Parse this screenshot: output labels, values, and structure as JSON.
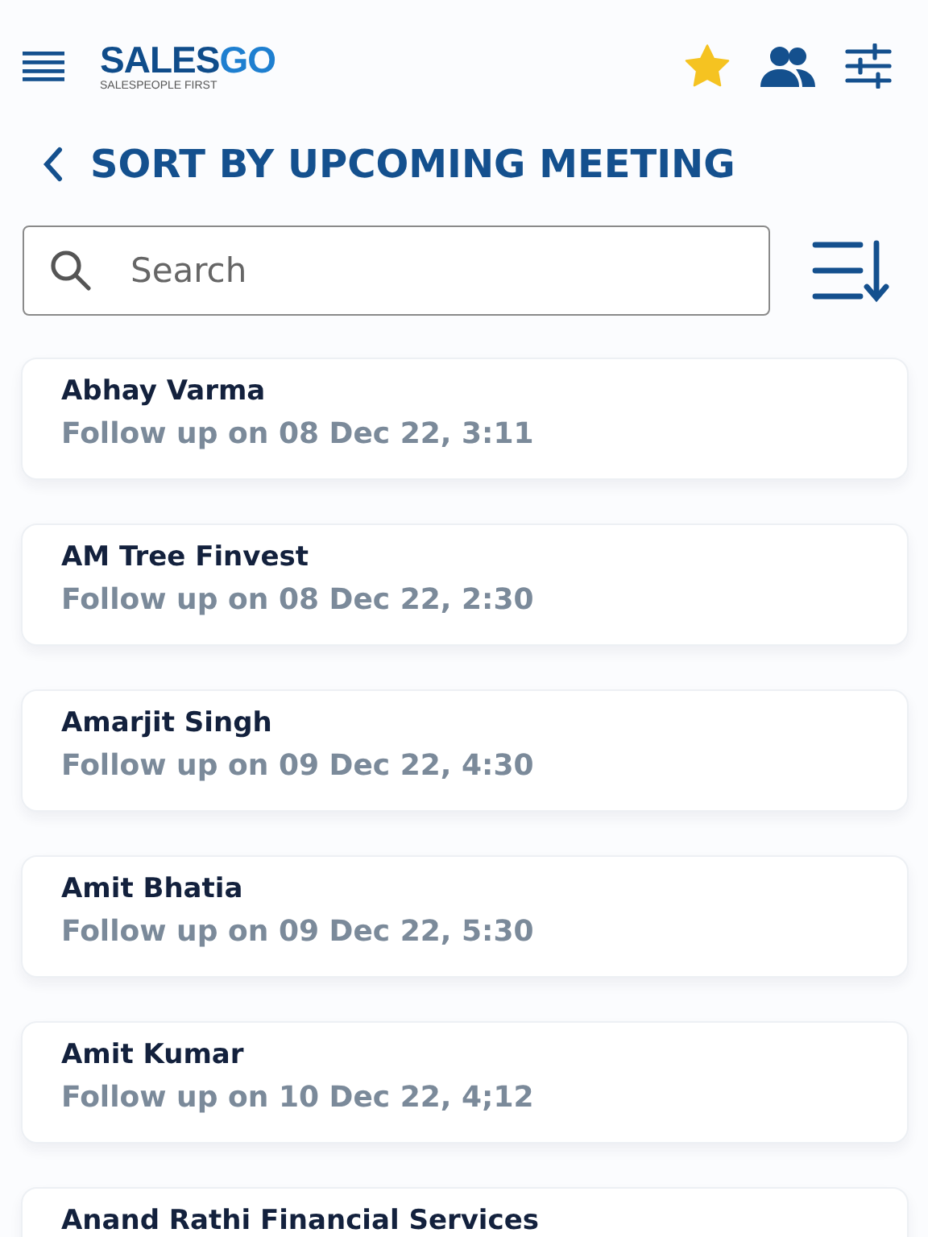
{
  "header": {
    "logo": {
      "word_1": "SALES",
      "word_2": "GO",
      "tagline": "SALESPEOPLE FIRST"
    }
  },
  "title": "SORT BY UPCOMING MEETING",
  "search": {
    "placeholder": "Search"
  },
  "contacts": [
    {
      "name": "Abhay Varma",
      "follow_up": "Follow up on 08 Dec 22, 3:11"
    },
    {
      "name": "AM Tree Finvest",
      "follow_up": "Follow up on 08 Dec 22, 2:30"
    },
    {
      "name": "Amarjit Singh",
      "follow_up": "Follow up on 09 Dec 22, 4:30"
    },
    {
      "name": "Amit Bhatia",
      "follow_up": "Follow up on 09 Dec 22, 5:30"
    },
    {
      "name": "Amit Kumar",
      "follow_up": "Follow up on 10 Dec 22, 4;12"
    },
    {
      "name": "Anand Rathi Financial Services"
    }
  ]
}
